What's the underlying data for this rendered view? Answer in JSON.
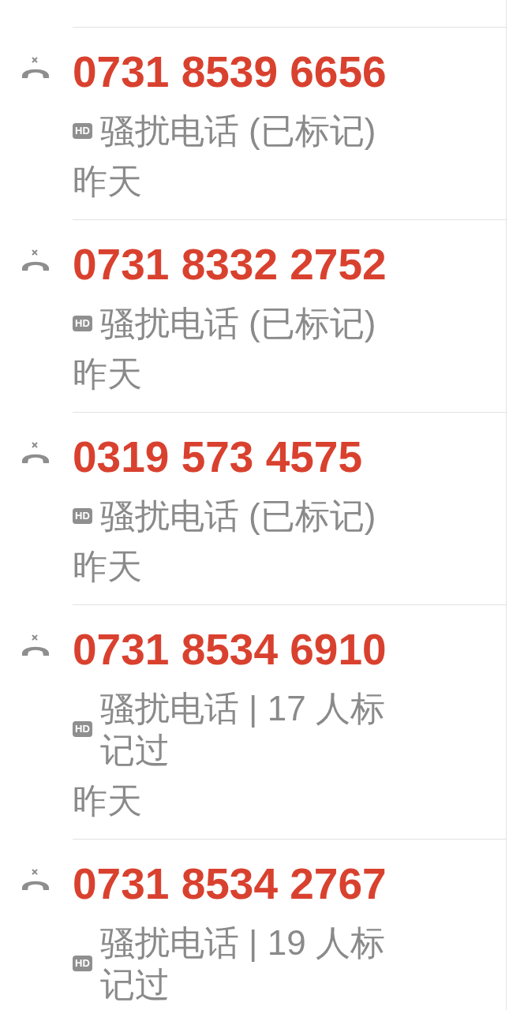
{
  "calls": [
    {
      "kind": "missed",
      "number": "0731 8539 6656",
      "badge": "HD",
      "label": "骚扰电话 (已标记)",
      "date": "昨天"
    },
    {
      "kind": "missed",
      "number": "0731 8332 2752",
      "badge": "HD",
      "label": "骚扰电话 (已标记)",
      "date": "昨天"
    },
    {
      "kind": "missed",
      "number": "0319 573 4575",
      "badge": "HD",
      "label": "骚扰电话 (已标记)",
      "date": "昨天"
    },
    {
      "kind": "missed",
      "number": "0731 8534 6910",
      "badge": "HD",
      "label": "骚扰电话 | 17 人标记过",
      "date": "昨天"
    },
    {
      "kind": "missed",
      "number": "0731 8534 2767",
      "badge": "HD",
      "label": "骚扰电话 | 19 人标记过"
    }
  ]
}
